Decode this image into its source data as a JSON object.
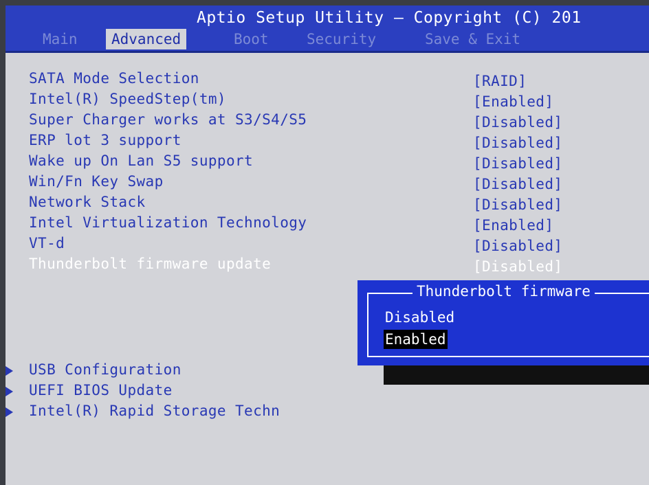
{
  "header": {
    "title": "Aptio Setup Utility – Copyright (C) 201",
    "tabs": [
      "Main",
      "Advanced",
      "Boot",
      "Security",
      "Save & Exit"
    ],
    "active_tab": "Advanced"
  },
  "settings": [
    {
      "label": "SATA Mode Selection",
      "value": "[RAID]"
    },
    {
      "label": "Intel(R) SpeedStep(tm)",
      "value": "[Enabled]"
    },
    {
      "label": "Super Charger works at S3/S4/S5",
      "value": "[Disabled]"
    },
    {
      "label": "ERP lot 3 support",
      "value": "[Disabled]"
    },
    {
      "label": "Wake up On Lan S5 support",
      "value": "[Disabled]"
    },
    {
      "label": "Win/Fn Key Swap",
      "value": "[Disabled]"
    },
    {
      "label": "Network Stack",
      "value": "[Disabled]"
    },
    {
      "label": "Intel Virtualization Technology",
      "value": "[Enabled]"
    },
    {
      "label": "VT-d",
      "value": "[Disabled]"
    },
    {
      "label": "Thunderbolt firmware update",
      "value": "[Disabled]"
    }
  ],
  "selected_setting": "Thunderbolt firmware update",
  "submenus": [
    "USB Configuration",
    "UEFI BIOS Update",
    "Intel(R) Rapid Storage Techn"
  ],
  "popup": {
    "title": "Thunderbolt firmware",
    "options": [
      "Disabled",
      "Enabled"
    ],
    "highlighted": "Enabled"
  },
  "colors": {
    "header_bg": "#2b3fc0",
    "body_bg": "#d3d4d9",
    "text": "#2838b4",
    "popup_bg": "#1d33d0",
    "highlight": "#000000"
  }
}
